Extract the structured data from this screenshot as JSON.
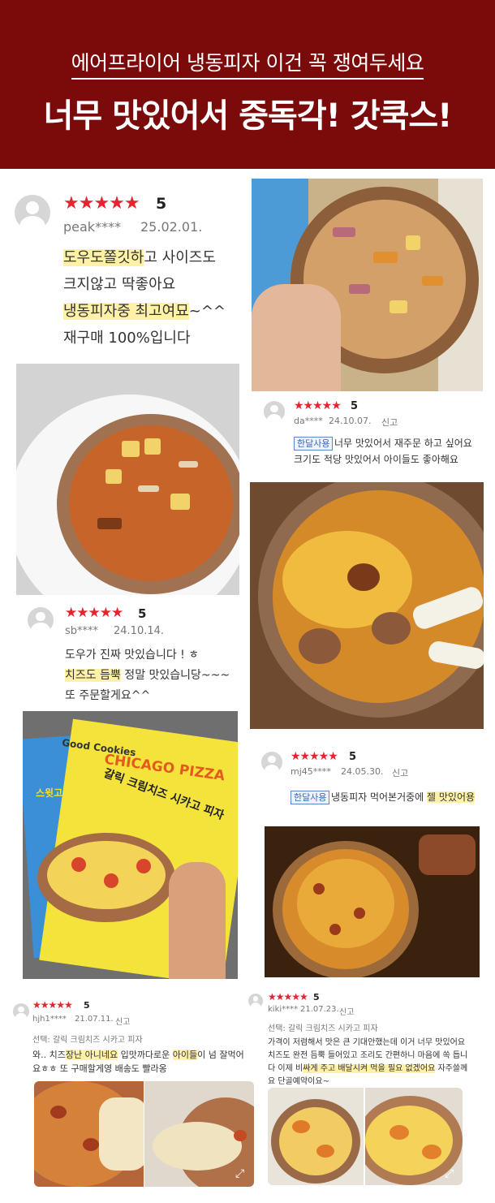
{
  "header": {
    "subtitle": "에어프라이어 냉동피자 이건 꼭 쟁여두세요",
    "headline": "너무 맛있어서 중독각! 갓쿡스!"
  },
  "colors": {
    "banner": "#7b0a0a",
    "stars": "#e8222f",
    "highlight": "#fff2a6",
    "tag": "#3b68b8"
  },
  "reviews": [
    {
      "stars": "★★★★★",
      "score": "5",
      "user": "peak****",
      "date": "25.02.01.",
      "lines": [
        {
          "hl": "도우도쫄깃하",
          "rest": "고 사이즈도"
        },
        {
          "hl": "",
          "rest": "크지않고 딱좋아요"
        },
        {
          "hl": "냉동피자중 최고여묘",
          "rest": "~^^"
        },
        {
          "hl": "",
          "rest": "재구매 100%입니다"
        }
      ]
    },
    {
      "stars": "★★★★★",
      "score": "5",
      "user": "da****",
      "date": "24.10.07.",
      "report": "신고",
      "tag": "한달사용",
      "line1": "너무 맛있어서 재주문 하고 싶어요",
      "line2": "크기도 적당 맛있어서 아이들도 좋아해요"
    },
    {
      "stars": "★★★★★",
      "score": "5",
      "user": "sb****",
      "date": "24.10.14.",
      "lines": [
        {
          "hl": "",
          "rest": "도우가 진짜 맛있습니다 ! ㅎ"
        },
        {
          "hl": "치즈도 듬뿍",
          "rest": " 정말 맛있습니당~~~"
        },
        {
          "hl": "",
          "rest": "또 주문할게요^^"
        }
      ]
    },
    {
      "stars": "★★★★★",
      "score": "5",
      "user": "mj45****",
      "date": "24.05.30.",
      "report": "신고",
      "tag": "한달사용",
      "text": "냉동피자 먹어본거중에 ",
      "hl": "젤 맛있어용"
    },
    {
      "stars": "★★★★★",
      "score": "5",
      "user": "hjh1****",
      "date": "21.07.11.",
      "report": "신고",
      "option": "선택: 갈릭 크림치즈 시카고 피자",
      "line1a": "와.. 치즈",
      "line1hl": "장난 아니네요",
      "line1b": " 입맛까다로운 ",
      "line1hl2": "아이들",
      "line1c": "이 넘  잘먹어",
      "line2": "요ㅎㅎ 또 구매할게영 배송도 빨라옹"
    },
    {
      "stars": "★★★★★",
      "score": "5",
      "user": "kiki****",
      "date": "21.07.23.",
      "report": "신고",
      "option": "선택: 갈릭 크림치즈 시카고 피자",
      "line1": "가격이 저렴해서 맛은 큰 기대안했는데 이거 너무 맛있어요",
      "line2": "치즈도 완전 듬뿍 들어있고 조리도 간편하니 마음에 쏙 듭니",
      "line3a": "다 이제 비",
      "line3hl": "싸게 주고 배달시켜 먹을 필요 없겠어요",
      "line3b": " 자주쓸께",
      "line4": "요 단골예약이요~"
    }
  ],
  "package": {
    "brand": "Good Cookies",
    "title": "CHICAGO PIZZA",
    "name": "갈릭 크림치즈 시카고 피자",
    "small": "스윗고"
  }
}
